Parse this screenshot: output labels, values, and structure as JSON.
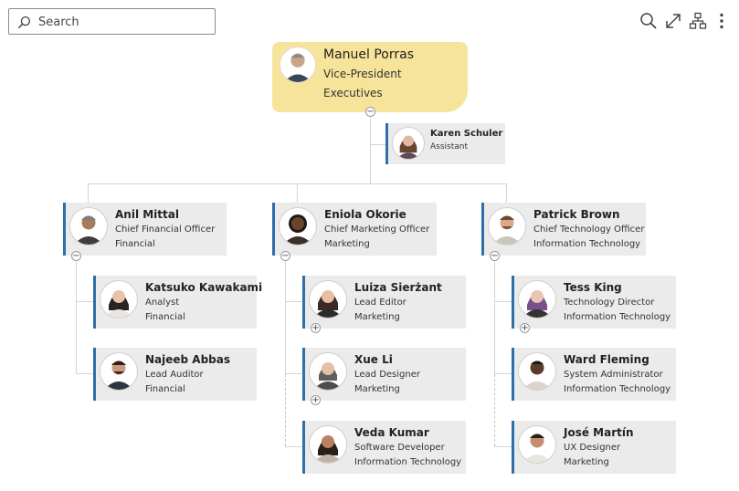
{
  "search": {
    "placeholder": "Search"
  },
  "toolbar": {
    "search_icon": "search-icon",
    "fullscreen_icon": "expand-icon",
    "layout_icon": "org-layout-icon",
    "more_icon": "more-vertical-icon"
  },
  "root": {
    "name": "Manuel Porras",
    "title": "Vice-President",
    "dept": "Executives"
  },
  "assistant": {
    "name": "Karen Schuler",
    "title": "Assistant"
  },
  "managers": [
    {
      "name": "Anil Mittal",
      "title": "Chief Financial Officer",
      "dept": "Financial"
    },
    {
      "name": "Eniola Okorie",
      "title": "Chief Marketing Officer",
      "dept": "Marketing"
    },
    {
      "name": "Patrick Brown",
      "title": "Chief Technology Officer",
      "dept": "Information Technology"
    }
  ],
  "reports": {
    "anil": [
      {
        "name": "Katsuko Kawakami",
        "title": "Analyst",
        "dept": "Financial"
      },
      {
        "name": "Najeeb Abbas",
        "title": "Lead Auditor",
        "dept": "Financial"
      }
    ],
    "eniola": [
      {
        "name": "Luiza Sierżant",
        "title": "Lead Editor",
        "dept": "Marketing"
      },
      {
        "name": "Xue Li",
        "title": "Lead Designer",
        "dept": "Marketing"
      },
      {
        "name": "Veda Kumar",
        "title": "Software Developer",
        "dept": "Information Technology"
      }
    ],
    "patrick": [
      {
        "name": "Tess King",
        "title": "Technology Director",
        "dept": "Information Technology"
      },
      {
        "name": "Ward Fleming",
        "title": "System Administrator",
        "dept": "Information Technology"
      },
      {
        "name": "José Martín",
        "title": "UX Designer",
        "dept": "Marketing"
      }
    ]
  },
  "toggles": {
    "collapse": "−",
    "expand": "+"
  },
  "colors": {
    "accent": "#2e6fa7",
    "root_bg": "#f7e49b",
    "card_bg": "#ebebeb"
  }
}
